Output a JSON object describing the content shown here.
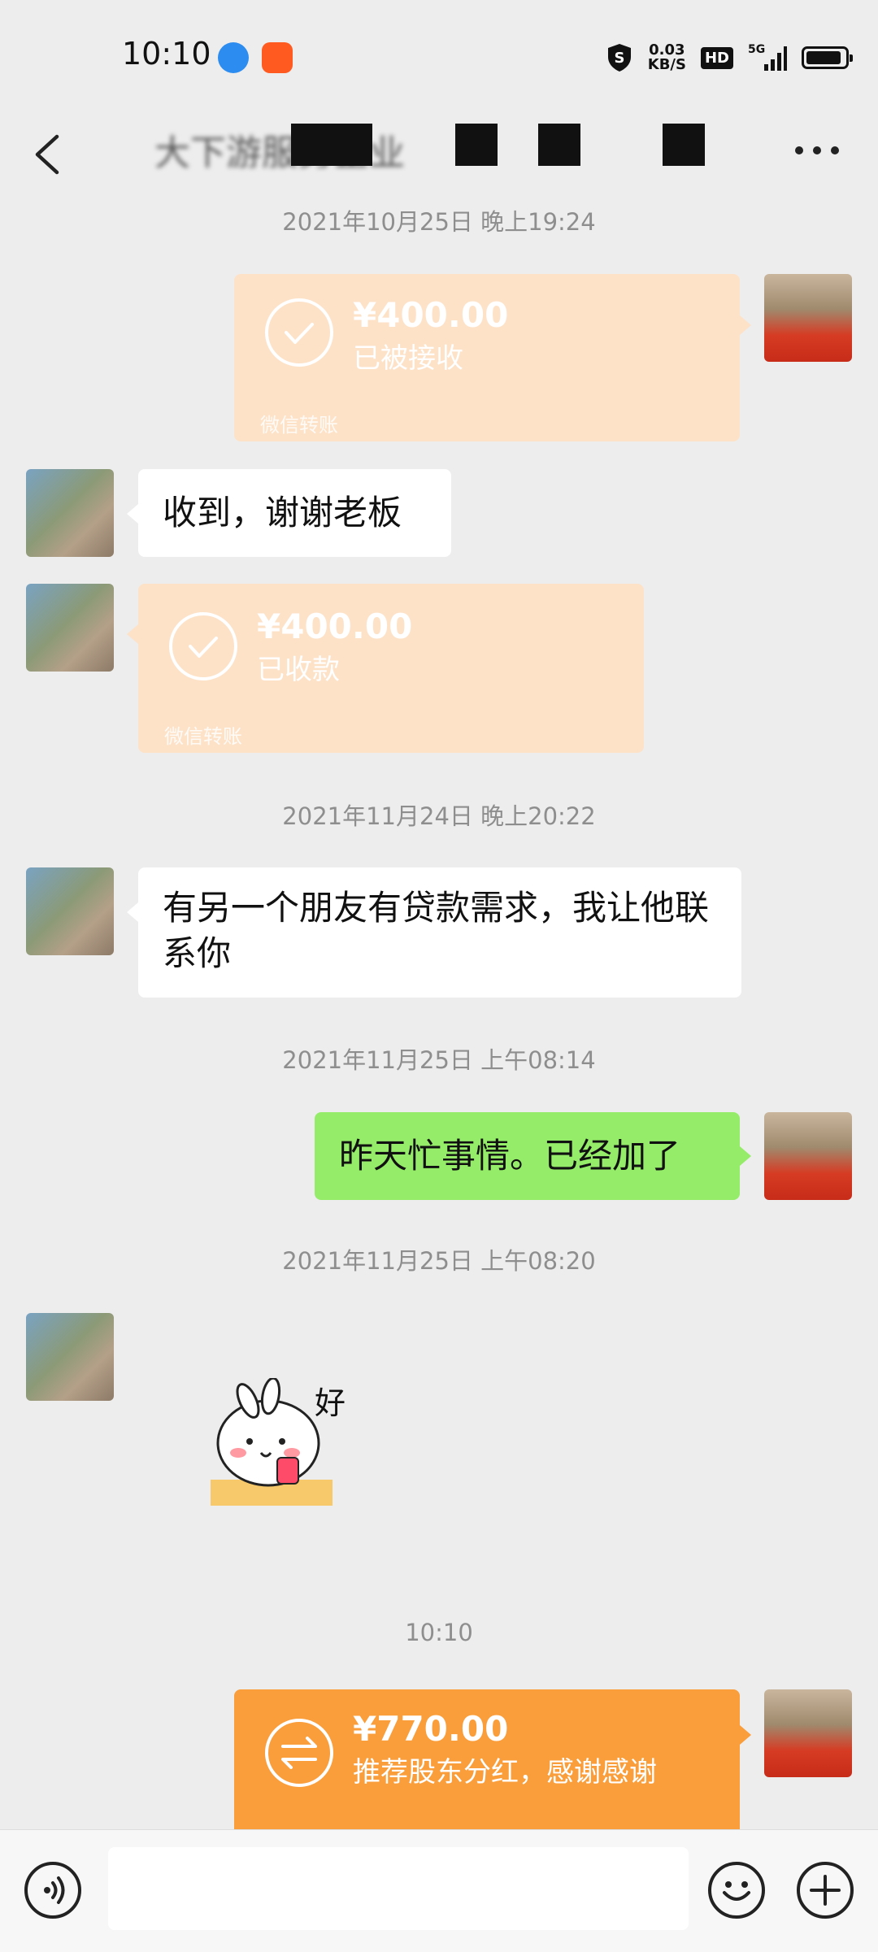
{
  "status_bar": {
    "time": "10:10",
    "net_speed_value": "0.03",
    "net_speed_unit": "KB/S",
    "hd": "HD",
    "signal": "5G"
  },
  "header": {
    "title": "大下游服务企业"
  },
  "messages": {
    "ts1": "2021年10月25日 晚上19:24",
    "t1_amount": "¥400.00",
    "t1_status": "已被接收",
    "t1_footer": "微信转账",
    "m1_text": "收到，谢谢老板",
    "t2_amount": "¥400.00",
    "t2_status": "已收款",
    "t2_footer": "微信转账",
    "ts2": "2021年11月24日 晚上20:22",
    "m2_text": "有另一个朋友有贷款需求，我让他联系你",
    "ts3": "2021年11月25日 上午08:14",
    "m3_text": "昨天忙事情。已经加了",
    "ts4": "2021年11月25日 上午08:20",
    "sticker_text": "好",
    "ts5": "10:10",
    "t3_amount": "¥770.00",
    "t3_note": "推荐股东分红，感谢感谢"
  },
  "colors": {
    "accent_orange": "#fa9d3b",
    "faded_orange": "#fde2c8",
    "green_bubble": "#95ec69"
  }
}
